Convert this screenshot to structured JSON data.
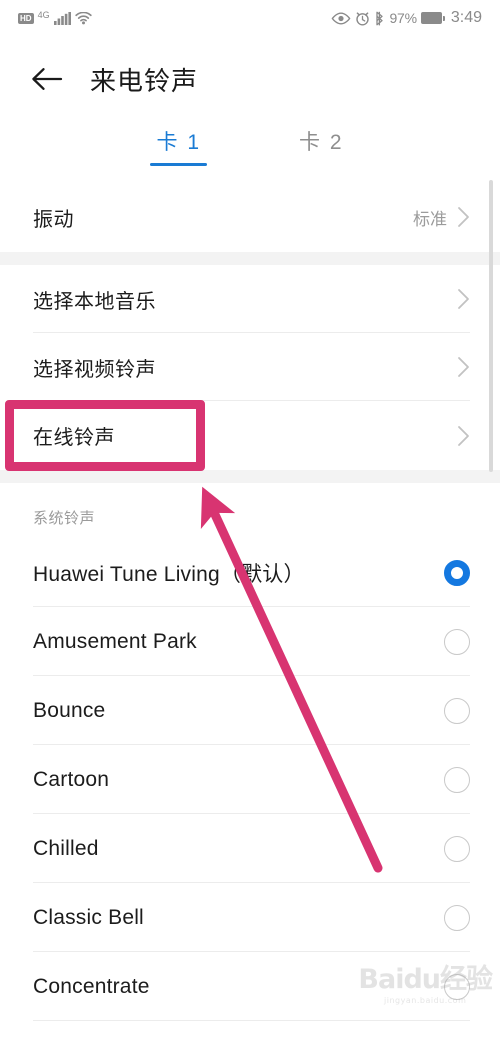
{
  "statusbar": {
    "hd_label": "HD",
    "network_label": "4G",
    "signal_icon": "signal-bars-icon",
    "wifi_icon": "wifi-icon",
    "eye_icon": "eye-comfort-icon",
    "alarm_icon": "alarm-clock-icon",
    "bluetooth_icon": "bluetooth-icon",
    "battery_percent": "97%",
    "battery_icon": "battery-full-icon",
    "time": "3:49"
  },
  "header": {
    "back_icon": "back-arrow-icon",
    "title": "来电铃声"
  },
  "tabs": [
    {
      "label": "卡 1",
      "active": true
    },
    {
      "label": "卡 2",
      "active": false
    }
  ],
  "vibration_block": {
    "rows": [
      {
        "label": "振动",
        "value": "标准",
        "chevron": "chevron-right-icon"
      }
    ]
  },
  "source_block": {
    "rows": [
      {
        "label": "选择本地音乐",
        "value": "",
        "chevron": "chevron-right-icon"
      },
      {
        "label": "选择视频铃声",
        "value": "",
        "chevron": "chevron-right-icon"
      },
      {
        "label": "在线铃声",
        "value": "",
        "chevron": "chevron-right-icon"
      }
    ]
  },
  "system_section": {
    "title": "系统铃声",
    "ringtones": [
      {
        "name": "Huawei Tune Living（默认）",
        "selected": true
      },
      {
        "name": "Amusement Park",
        "selected": false
      },
      {
        "name": "Bounce",
        "selected": false
      },
      {
        "name": "Cartoon",
        "selected": false
      },
      {
        "name": "Chilled",
        "selected": false
      },
      {
        "name": "Classic Bell",
        "selected": false
      },
      {
        "name": "Concentrate",
        "selected": false
      }
    ]
  },
  "annotation": {
    "highlight_target": "在线铃声",
    "highlight_color": "#d83471",
    "arrow_color": "#d83471",
    "arrow_tip": "206,500",
    "arrow_tail": "378,868"
  },
  "watermark": {
    "text": "Baidu经验",
    "subtext": "jingyan.baidu.com"
  },
  "theme": {
    "accent_blue": "#1a7bd4",
    "radio_blue": "#1478e0",
    "text_primary": "#1c1c1c",
    "text_secondary": "#9b9b9b",
    "gap_gray": "#f3f3f3",
    "divider": "#ececec"
  },
  "scrollbar": {
    "name": "vertical-scrollbar"
  }
}
